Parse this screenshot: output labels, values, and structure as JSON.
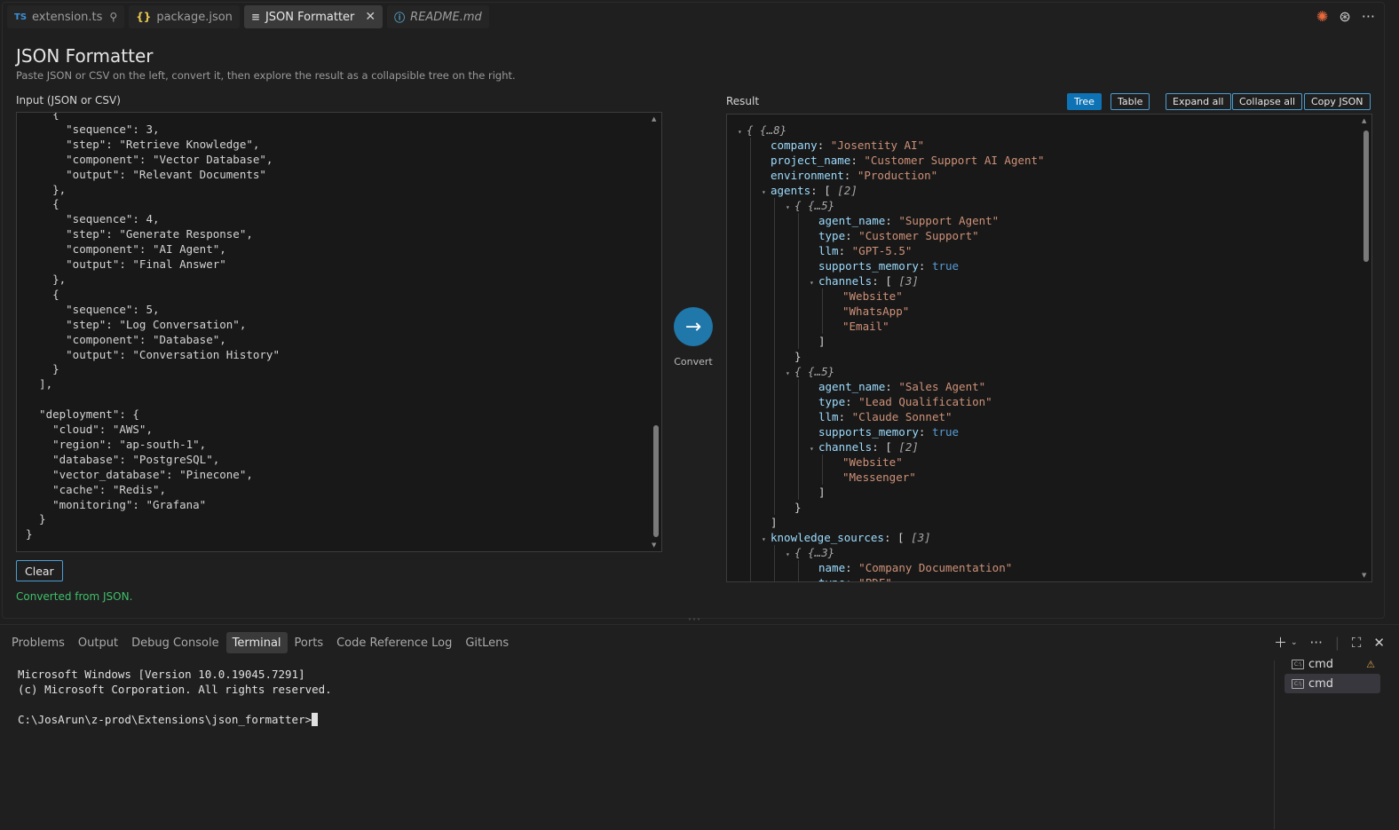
{
  "tabs": [
    {
      "icon": "TS",
      "label": "extension.ts",
      "pinned": true
    },
    {
      "icon": "{}",
      "label": "package.json"
    },
    {
      "icon": "≡",
      "label": "JSON Formatter",
      "active": true
    },
    {
      "icon": "ⓘ",
      "label": "README.md"
    }
  ],
  "page": {
    "title": "JSON Formatter",
    "subtitle": "Paste JSON or CSV on the left, convert it, then explore the result as a collapsible tree on the right.",
    "input_label": "Input (JSON or CSV)",
    "input_text": "    {\n      \"sequence\": 3,\n      \"step\": \"Retrieve Knowledge\",\n      \"component\": \"Vector Database\",\n      \"output\": \"Relevant Documents\"\n    },\n    {\n      \"sequence\": 4,\n      \"step\": \"Generate Response\",\n      \"component\": \"AI Agent\",\n      \"output\": \"Final Answer\"\n    },\n    {\n      \"sequence\": 5,\n      \"step\": \"Log Conversation\",\n      \"component\": \"Database\",\n      \"output\": \"Conversation History\"\n    }\n  ],\n\n  \"deployment\": {\n    \"cloud\": \"AWS\",\n    \"region\": \"ap-south-1\",\n    \"database\": \"PostgreSQL\",\n    \"vector_database\": \"Pinecone\",\n    \"cache\": \"Redis\",\n    \"monitoring\": \"Grafana\"\n  }\n}",
    "clear_label": "Clear",
    "status": "Converted from JSON.",
    "convert_label": "Convert",
    "convert_icon": "→",
    "result_label": "Result",
    "result_buttons": {
      "tree": "Tree",
      "table": "Table",
      "expand": "Expand all",
      "collapse": "Collapse all",
      "copy": "Copy JSON"
    }
  },
  "tree": [
    {
      "d": 0,
      "caret": true,
      "meta": "{ {…8}"
    },
    {
      "d": 1,
      "key": "company",
      "str": "\"Josentity AI\""
    },
    {
      "d": 1,
      "key": "project_name",
      "str": "\"Customer Support AI Agent\""
    },
    {
      "d": 1,
      "key": "environment",
      "str": "\"Production\""
    },
    {
      "d": 1,
      "caret": true,
      "key": "agents",
      "punct": "[",
      "meta": "[2]"
    },
    {
      "d": 2,
      "caret": true,
      "meta": "{ {…5}"
    },
    {
      "d": 3,
      "key": "agent_name",
      "str": "\"Support Agent\""
    },
    {
      "d": 3,
      "key": "type",
      "str": "\"Customer Support\""
    },
    {
      "d": 3,
      "key": "llm",
      "str": "\"GPT-5.5\""
    },
    {
      "d": 3,
      "key": "supports_memory",
      "bool": "true"
    },
    {
      "d": 3,
      "caret": true,
      "key": "channels",
      "punct": "[",
      "meta": "[3]"
    },
    {
      "d": 4,
      "str": "\"Website\""
    },
    {
      "d": 4,
      "str": "\"WhatsApp\""
    },
    {
      "d": 4,
      "str": "\"Email\""
    },
    {
      "d": 3,
      "punct": "]"
    },
    {
      "d": 2,
      "punct": "}"
    },
    {
      "d": 2,
      "caret": true,
      "meta": "{ {…5}"
    },
    {
      "d": 3,
      "key": "agent_name",
      "str": "\"Sales Agent\""
    },
    {
      "d": 3,
      "key": "type",
      "str": "\"Lead Qualification\""
    },
    {
      "d": 3,
      "key": "llm",
      "str": "\"Claude Sonnet\""
    },
    {
      "d": 3,
      "key": "supports_memory",
      "bool": "true"
    },
    {
      "d": 3,
      "caret": true,
      "key": "channels",
      "punct": "[",
      "meta": "[2]"
    },
    {
      "d": 4,
      "str": "\"Website\""
    },
    {
      "d": 4,
      "str": "\"Messenger\""
    },
    {
      "d": 3,
      "punct": "]"
    },
    {
      "d": 2,
      "punct": "}"
    },
    {
      "d": 1,
      "punct": "]"
    },
    {
      "d": 1,
      "caret": true,
      "key": "knowledge_sources",
      "punct": "[",
      "meta": "[3]"
    },
    {
      "d": 2,
      "caret": true,
      "meta": "{ {…3}"
    },
    {
      "d": 3,
      "key": "name",
      "str": "\"Company Documentation\""
    },
    {
      "d": 3,
      "key": "type",
      "str": "\"PDF\""
    }
  ],
  "panel": {
    "tabs": [
      "Problems",
      "Output",
      "Debug Console",
      "Terminal",
      "Ports",
      "Code Reference Log",
      "GitLens"
    ],
    "active_tab": "Terminal",
    "terminal_lines": [
      "Microsoft Windows [Version 10.0.19045.7291]",
      "(c) Microsoft Corporation. All rights reserved.",
      "",
      "C:\\JosArun\\z-prod\\Extensions\\json_formatter>"
    ],
    "terminals": [
      {
        "label": "cmd",
        "warning": true
      },
      {
        "label": "cmd",
        "active": true
      }
    ]
  }
}
